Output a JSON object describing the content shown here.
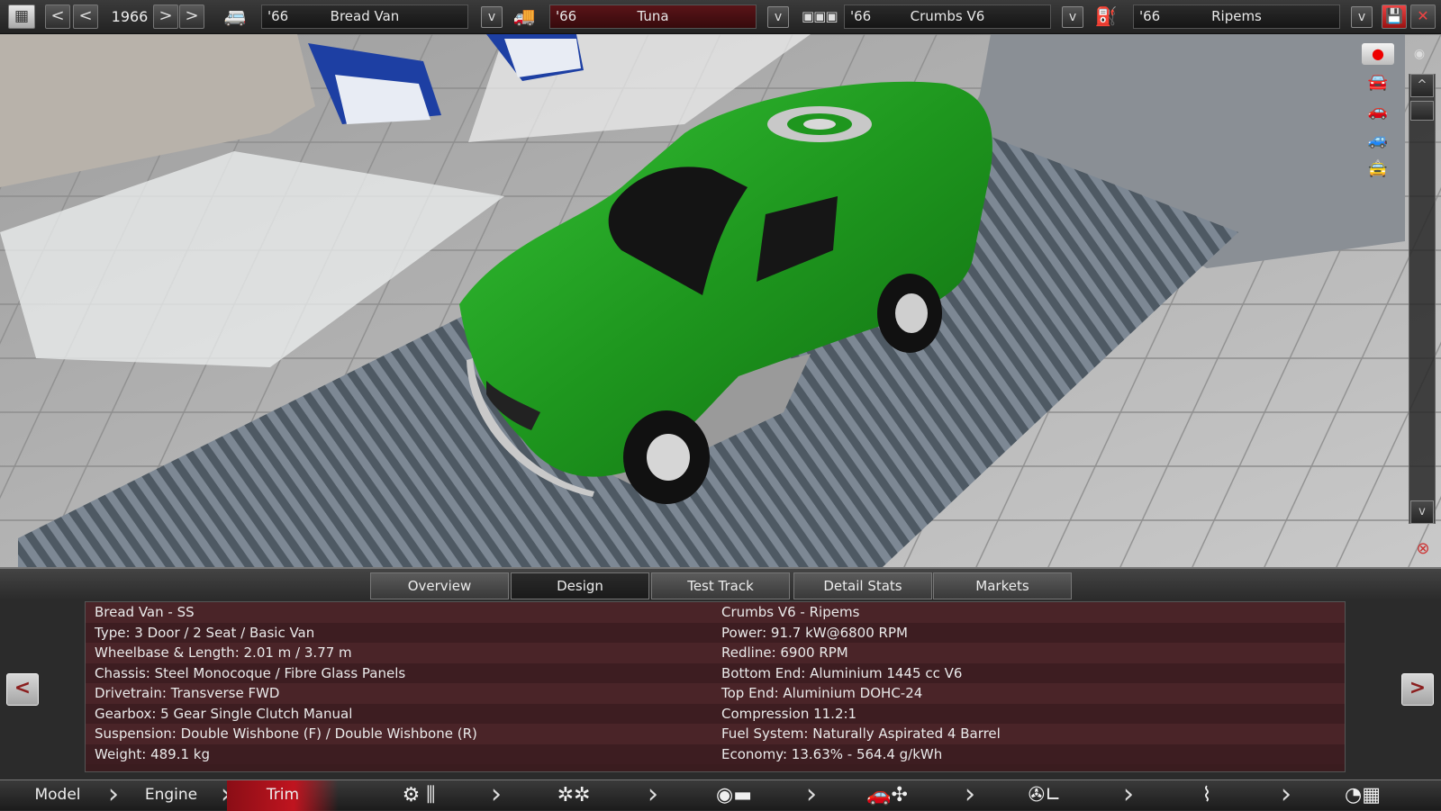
{
  "topbar": {
    "year": "1966",
    "prev_fast": "<",
    "prev": "<",
    "next": ">",
    "next_fast": ">",
    "model": {
      "year": "'66",
      "name": "Bread Van"
    },
    "trim": {
      "year": "'66",
      "name": "Tuna"
    },
    "engine": {
      "year": "'66",
      "name": "Crumbs V6"
    },
    "engine_variant": {
      "year": "'66",
      "name": "Ripems"
    },
    "dropdown": "v",
    "close": "✕"
  },
  "rail": {
    "up": "^",
    "down": "v"
  },
  "tabs": [
    "Overview",
    "Design",
    "Test Track",
    "Detail Stats",
    "Markets"
  ],
  "active_tab": "Design",
  "stats": {
    "left": [
      "Bread Van - SS",
      "Type: 3 Door / 2 Seat / Basic Van",
      "Wheelbase & Length: 2.01 m / 3.77 m",
      "Chassis: Steel Monocoque / Fibre Glass Panels",
      "Drivetrain: Transverse FWD",
      "Gearbox: 5 Gear Single Clutch Manual",
      "Suspension: Double Wishbone (F) / Double Wishbone (R)",
      "Weight: 489.1 kg"
    ],
    "right": [
      "Crumbs V6 - Ripems",
      "Power: 91.7 kW@6800 RPM",
      "Redline: 6900 RPM",
      "Bottom End: Aluminium 1445 cc V6",
      "Top End: Aluminium DOHC-24",
      "Compression 11.2:1",
      "Fuel System: Naturally Aspirated 4 Barrel",
      "Economy: 13.63% - 564.4 g/kWh"
    ]
  },
  "panel_nav": {
    "prev": "<",
    "next": ">"
  },
  "bottomnav": {
    "model": "Model",
    "engine": "Engine",
    "trim": "Trim"
  },
  "colors": {
    "accent": "#c0141f",
    "car": "#1f9a1f"
  }
}
